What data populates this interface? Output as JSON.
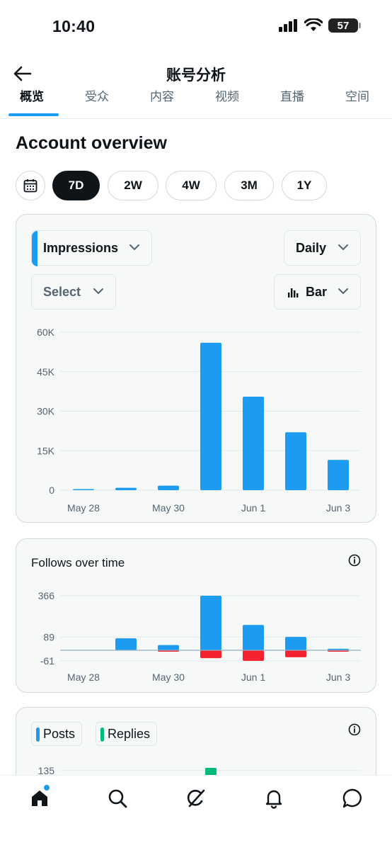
{
  "status_bar": {
    "time": "10:40",
    "battery": "57"
  },
  "header": {
    "title": "账号分析"
  },
  "tabs": [
    {
      "label": "概览",
      "active": true
    },
    {
      "label": "受众",
      "active": false
    },
    {
      "label": "内容",
      "active": false
    },
    {
      "label": "视频",
      "active": false
    },
    {
      "label": "直播",
      "active": false
    },
    {
      "label": "空间",
      "active": false
    }
  ],
  "overview": {
    "title": "Account overview"
  },
  "ranges": [
    {
      "label": "7D",
      "active": true
    },
    {
      "label": "2W",
      "active": false
    },
    {
      "label": "4W",
      "active": false
    },
    {
      "label": "3M",
      "active": false
    },
    {
      "label": "1Y",
      "active": false
    }
  ],
  "impressions_card": {
    "metric_dropdown": "Impressions",
    "interval_dropdown": "Daily",
    "compare_dropdown": "Select",
    "chart_type_dropdown": "Bar"
  },
  "follows_card": {
    "title": "Follows over time"
  },
  "posts_card": {
    "legend_posts": "Posts",
    "legend_replies": "Replies"
  },
  "colors": {
    "accent": "#1d9bf0",
    "negative": "#f4212e",
    "replies": "#00ba7c"
  },
  "chart_data": [
    {
      "type": "bar",
      "categories": [
        "May 28",
        "May 29",
        "May 30",
        "May 31",
        "Jun 1",
        "Jun 2",
        "Jun 3"
      ],
      "x_tick_labels": [
        "May 28",
        "May 30",
        "Jun 1",
        "Jun 3"
      ],
      "series": [
        {
          "name": "Impressions",
          "values": [
            300,
            900,
            1700,
            56000,
            35500,
            22000,
            11500
          ]
        }
      ],
      "y_ticks": [
        "60K",
        "45K",
        "30K",
        "15K",
        "0"
      ],
      "ylim": [
        0,
        60000
      ],
      "grid": true
    },
    {
      "type": "bar",
      "categories": [
        "May 28",
        "May 29",
        "May 30",
        "May 31",
        "Jun 1",
        "Jun 2",
        "Jun 3"
      ],
      "x_tick_labels": [
        "May 28",
        "May 30",
        "Jun 1",
        "Jun 3"
      ],
      "series": [
        {
          "values": [
            0,
            80,
            35,
            366,
            170,
            90,
            10
          ]
        },
        {
          "values": [
            0,
            0,
            -8,
            -45,
            -61,
            -40,
            -8
          ]
        }
      ],
      "y_ticks": [
        "366",
        "89",
        "-61"
      ],
      "ylim": [
        -61,
        366
      ],
      "grid": true
    },
    {
      "type": "bar",
      "categories": [
        "May 28",
        "May 29",
        "May 30",
        "May 31",
        "Jun 1",
        "Jun 2",
        "Jun 3"
      ],
      "series": [
        {
          "name": "Posts",
          "values": []
        },
        {
          "name": "Replies",
          "values": [
            null,
            null,
            null,
            135,
            null,
            null,
            null
          ]
        }
      ],
      "y_ticks": [
        "135"
      ],
      "grid": true
    }
  ]
}
